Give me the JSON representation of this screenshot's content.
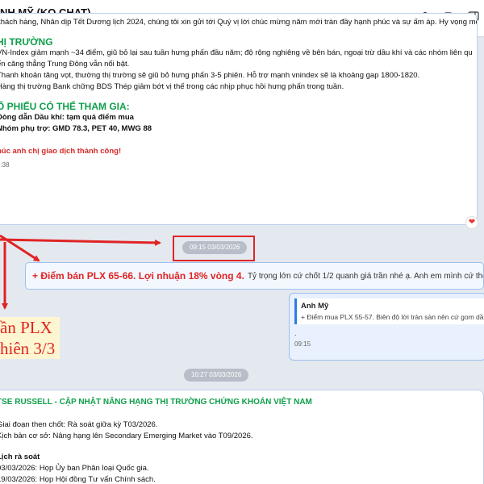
{
  "header": {
    "title": "NH MỸ (KO CHAT)",
    "sub_left": "n",
    "tag_label": "SW",
    "icons": [
      "add-member-icon",
      "video-call-icon",
      "sidebar-toggle-icon"
    ]
  },
  "top_message": {
    "intro": "khách hàng, Nhân dịp Tết Dương lịch 2024, chúng tôi xin gửi tới Quý vị lời chúc mừng năm mới tràn đầy hạnh phúc và sự ấm áp. Hy vọng mỗi khoảnh khắc của",
    "section1_title": "HỊ TRƯỜNG",
    "section1_lines": [
      "VN-Index giảm mạnh ~34 điểm, giũ bỏ lại sau tuần hưng phấn đầu năm; độ rộng nghiêng về bên bán, ngoại trừ dầu khí và các nhóm liên qu",
      "ến căng thẳng Trung Đông vẫn nổi bật.",
      "Thanh khoản tăng vọt, thường thị trường sẽ giũ bỏ hưng phấn 3-5 phiên. Hỗ trợ mạnh vnindex sẽ là khoảng gap 1800-1820.",
      "Hàng thị trường Bank chững BDS Thép giảm bớt vị thế trong các nhịp phục hồi hưng phấn trong tuần."
    ],
    "section2_title": "Ổ PHIẾU CÓ THỂ THAM GIA:",
    "section2_lines": [
      "Dòng dẫn Dầu khí: tạm quá điểm mua",
      "Nhóm phụ trợ: GMD 78.3, PET 40, MWG 88"
    ],
    "wish": "húc anh chị giao dịch thành công!",
    "time": "8:38",
    "reaction": "❤"
  },
  "date_pills": {
    "first": "09:15 03/03/2026",
    "second": "10:27 03/03/2026"
  },
  "pin_message": {
    "hot": "+ Điểm bán PLX 65-66. Lợi nhuận 18% vòng 4.",
    "rest": "Tỷ trọng lớn cứ chốt 1/2 quanh giá trần nhé ạ. Anh em mình cứ thế thôi",
    "emoji": "😊"
  },
  "quote_message": {
    "author": "Anh Mỹ",
    "text": "+ Điểm mua PLX 55-57. Biên độ lời tràn sàn nên cứ gom dầ",
    "dot": ".",
    "time": "09:15"
  },
  "annotation": {
    "line1": "ần PLX",
    "line2": "hiên 3/3"
  },
  "bottom_message": {
    "title": "TSE RUSSELL - CẬP NHẬT NÂNG HẠNG THỊ TRƯỜNG CHỨNG KHOÁN VIỆT NAM",
    "lines": [
      "Giai đoạn then chốt: Rà soát giữa kỳ T03/2026.",
      "Kịch bản cơ sở: Nâng hạng lên Secondary Emerging Market vào T09/2026."
    ],
    "sub_title": "Lịch rà soát",
    "schedule": [
      "03/03/2026: Họp Ủy ban Phân loại Quốc gia.",
      "19/03/2026: Họp Hội đồng Tư vấn Chính sách."
    ]
  },
  "colors": {
    "accent_green": "#0e9f4a",
    "alert_red": "#e02424",
    "link_blue": "#2f7de1"
  }
}
